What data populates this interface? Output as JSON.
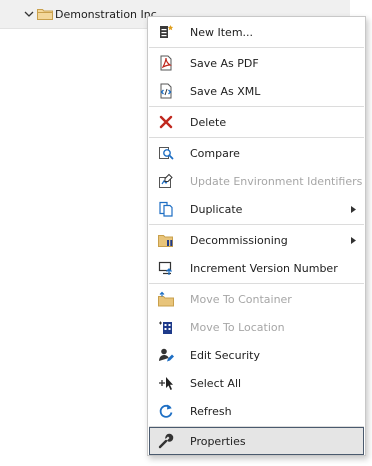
{
  "tree": {
    "node_label": "Demonstration Inc"
  },
  "menu": {
    "items": [
      {
        "label": "New Item...",
        "icon": "new-item-icon",
        "disabled": false
      },
      {
        "label": "Save As PDF",
        "icon": "pdf-icon",
        "disabled": false
      },
      {
        "label": "Save As XML",
        "icon": "xml-icon",
        "disabled": false
      },
      {
        "label": "Delete",
        "icon": "delete-icon",
        "disabled": false
      },
      {
        "label": "Compare",
        "icon": "compare-icon",
        "disabled": false
      },
      {
        "label": "Update Environment Identifiers",
        "icon": "update-identifiers-icon",
        "disabled": true
      },
      {
        "label": "Duplicate",
        "icon": "duplicate-icon",
        "disabled": false,
        "submenu": true
      },
      {
        "label": "Decommissioning",
        "icon": "decommissioning-icon",
        "disabled": false,
        "submenu": true
      },
      {
        "label": "Increment Version Number",
        "icon": "increment-version-icon",
        "disabled": false
      },
      {
        "label": "Move To Container",
        "icon": "move-container-icon",
        "disabled": true
      },
      {
        "label": "Move To Location",
        "icon": "move-location-icon",
        "disabled": true
      },
      {
        "label": "Edit Security",
        "icon": "edit-security-icon",
        "disabled": false
      },
      {
        "label": "Select All",
        "icon": "select-all-icon",
        "disabled": false
      },
      {
        "label": "Refresh",
        "icon": "refresh-icon",
        "disabled": false
      },
      {
        "label": "Properties",
        "icon": "properties-icon",
        "disabled": false,
        "selected": true
      }
    ]
  },
  "colors": {
    "accent_blue": "#1e6fc4",
    "delete_red": "#c0281e",
    "folder_tan": "#d9b36a",
    "selected_border": "#4a5a6e"
  }
}
